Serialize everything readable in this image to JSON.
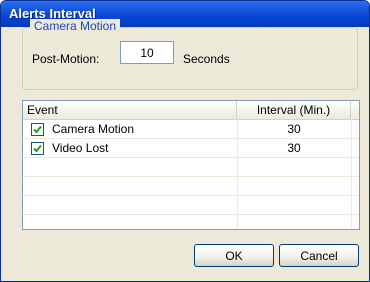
{
  "window": {
    "title": "Alerts Interval"
  },
  "camera_motion_group": {
    "legend": "Camera Motion",
    "post_motion_label": "Post-Motion:",
    "post_motion_value": "10",
    "seconds_label": "Seconds"
  },
  "event_list": {
    "columns": [
      "Event",
      "Interval (Min.)"
    ],
    "rows": [
      {
        "checked": true,
        "event": "Camera Motion",
        "interval": "30"
      },
      {
        "checked": true,
        "event": "Video Lost",
        "interval": "30"
      }
    ]
  },
  "buttons": {
    "ok": "OK",
    "cancel": "Cancel"
  },
  "colors": {
    "titlebar": "#0a48d6",
    "dialog_bg": "#ece9d8",
    "group_legend": "#1d47c6",
    "checkmark": "#21a121"
  },
  "icons": {
    "checkbox_checked": "checkmark-icon"
  }
}
